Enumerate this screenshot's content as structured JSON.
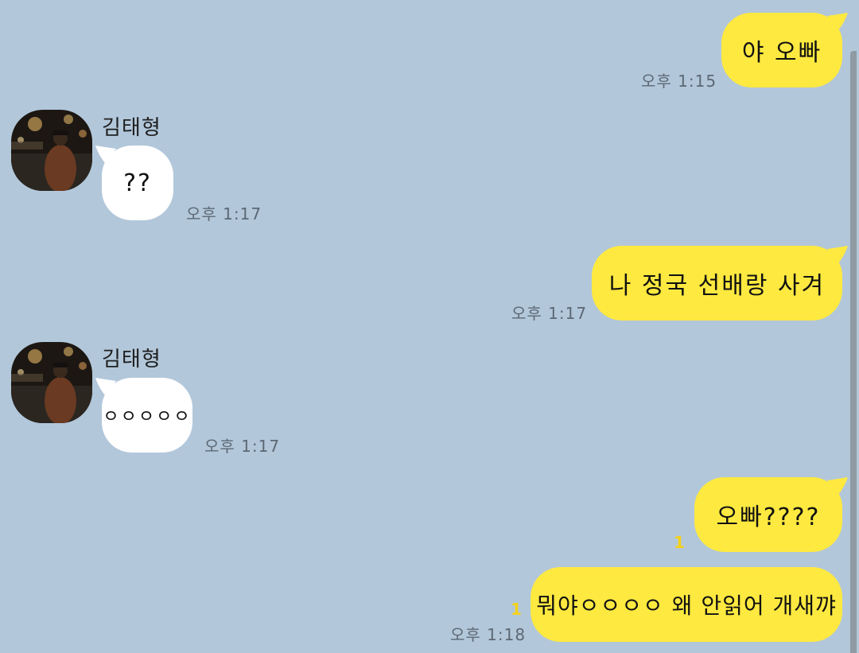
{
  "chat": {
    "contact_name": "김태형",
    "messages": [
      {
        "direction": "out",
        "text": "야 오빠",
        "time": "오후 1:15"
      },
      {
        "direction": "in",
        "sender": "김태형",
        "text": "??",
        "time": "오후 1:17"
      },
      {
        "direction": "out",
        "text": "나 정국 선배랑 사겨",
        "time": "오후 1:17"
      },
      {
        "direction": "in",
        "sender": "김태형",
        "text": "ㅇㅇㅇㅇㅇ",
        "time": "오후 1:17"
      },
      {
        "direction": "out",
        "text": "오빠????",
        "unread": "1"
      },
      {
        "direction": "out",
        "text": "뭐야ㅇㅇㅇㅇ 왜 안읽어 개새꺄",
        "unread": "1",
        "time": "오후 1:18"
      }
    ]
  },
  "colors": {
    "background": "#b2c7da",
    "outgoing_bubble": "#fee940",
    "incoming_bubble": "#ffffff",
    "unread_count": "#f5d21a",
    "time_text": "#5d6874"
  }
}
